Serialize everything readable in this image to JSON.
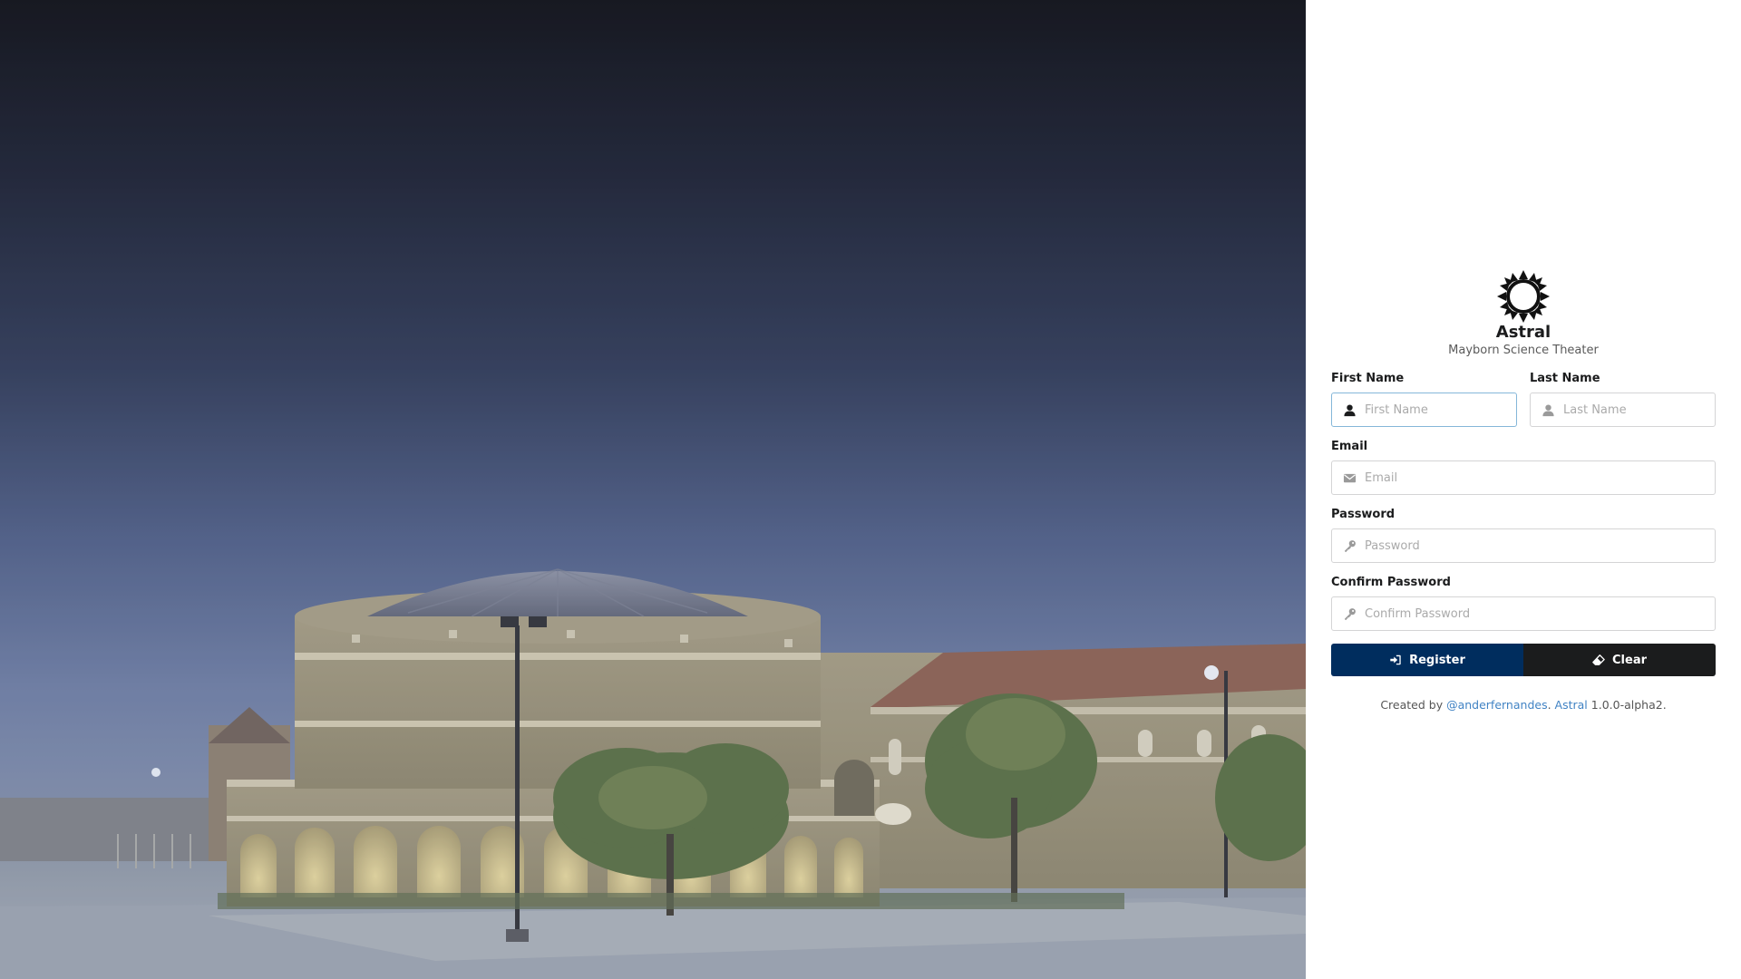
{
  "brand": {
    "name": "Astral",
    "subtitle": "Mayborn Science Theater"
  },
  "form": {
    "first_name": {
      "label": "First Name",
      "placeholder": "First Name",
      "value": "",
      "icon": "user-icon"
    },
    "last_name": {
      "label": "Last Name",
      "placeholder": "Last Name",
      "value": "",
      "icon": "user-icon"
    },
    "email": {
      "label": "Email",
      "placeholder": "Email",
      "value": "",
      "icon": "envelope-icon"
    },
    "password": {
      "label": "Password",
      "placeholder": "Password",
      "value": "",
      "icon": "key-icon"
    },
    "confirm_password": {
      "label": "Confirm Password",
      "placeholder": "Confirm Password",
      "value": "",
      "icon": "key-icon"
    }
  },
  "buttons": {
    "register": {
      "label": "Register",
      "icon": "sign-in-icon",
      "color": "#002d5e"
    },
    "clear": {
      "label": "Clear",
      "icon": "eraser-icon",
      "color": "#1b1c1d"
    }
  },
  "footer": {
    "prefix": "Created by",
    "author_link": "@anderfernandes",
    "separator": ".",
    "app_link": "Astral",
    "version": "1.0.0-alpha2."
  },
  "colors": {
    "accent": "#4183c4",
    "focus_border": "#85b7d9",
    "register_bg": "#002d5e",
    "clear_bg": "#1b1c1d"
  }
}
